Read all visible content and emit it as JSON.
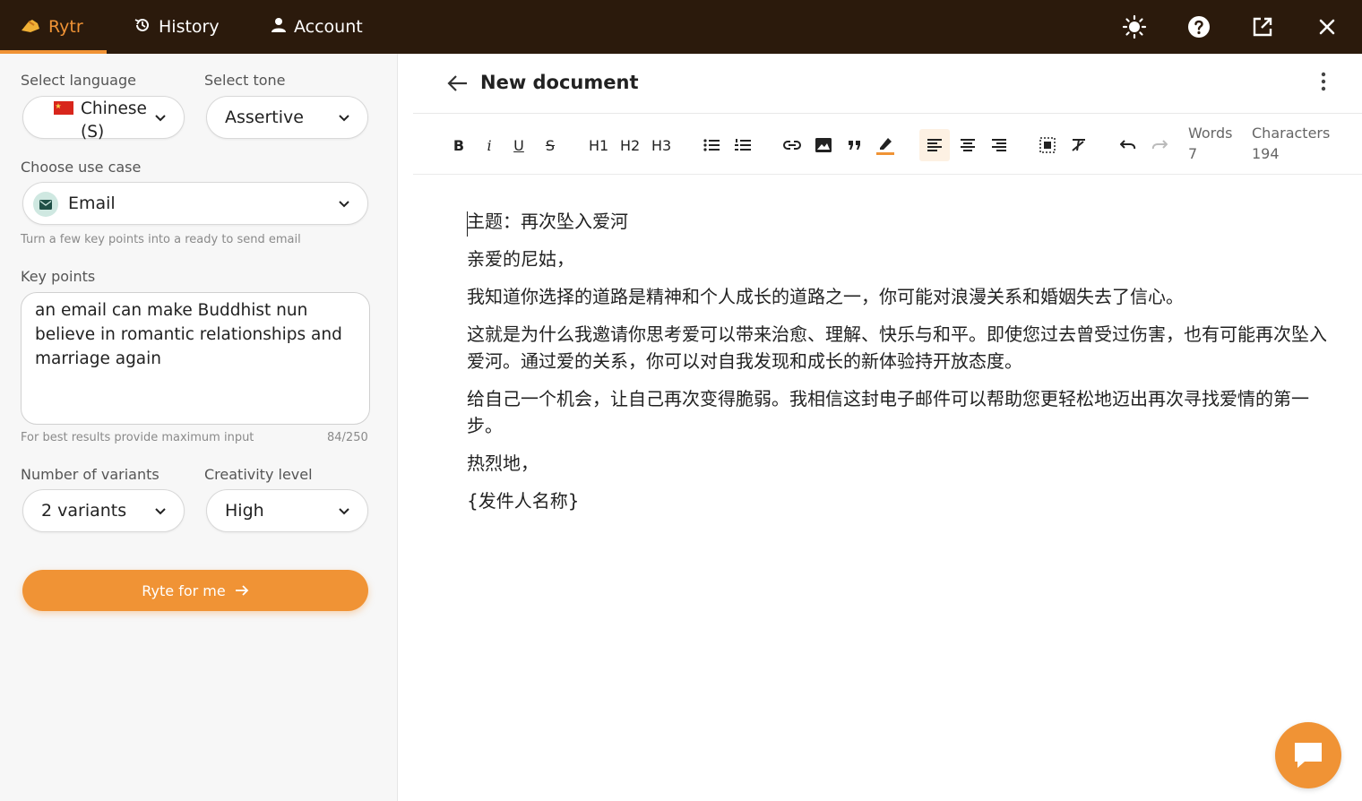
{
  "topbar": {
    "brand": "Rytr",
    "history": "History",
    "account": "Account"
  },
  "left": {
    "language_label": "Select language",
    "language_value": "Chinese (S)",
    "tone_label": "Select tone",
    "tone_value": "Assertive",
    "usecase_label": "Choose use case",
    "usecase_value": "Email",
    "usecase_hint": "Turn a few key points into a ready to send email",
    "keypoints_label": "Key points",
    "keypoints_value": "an email can make Buddhist nun believe in romantic relationships and marriage again",
    "keypoints_hint": "For best results provide maximum input",
    "keypoints_count": "84/250",
    "variants_label": "Number of variants",
    "variants_value": "2 variants",
    "creativity_label": "Creativity level",
    "creativity_value": "High",
    "cta_label": "Ryte for me"
  },
  "doc": {
    "title": "New document",
    "words_label": "Words",
    "words_value": "7",
    "chars_label": "Characters",
    "chars_value": "194",
    "toolbar": {
      "bold": "B",
      "italic": "i",
      "underline": "U",
      "strike": "S",
      "h1": "H1",
      "h2": "H2",
      "h3": "H3"
    },
    "paragraphs": [
      "主题：再次坠入爱河",
      "亲爱的尼姑，",
      "我知道你选择的道路是精神和个人成长的道路之一，你可能对浪漫关系和婚姻失去了信心。",
      "这就是为什么我邀请你思考爱可以带来治愈、理解、快乐与和平。即使您过去曾受过伤害，也有可能再次坠入爱河。通过爱的关系，你可以对自我发现和成长的新体验持开放态度。",
      "给自己一个机会，让自己再次变得脆弱。我相信这封电子邮件可以帮助您更轻松地迈出再次寻找爱情的第一步。",
      "热烈地，",
      "{发件人名称}"
    ]
  },
  "colors": {
    "accent": "#f09335",
    "topbar": "#2b1a0c"
  }
}
